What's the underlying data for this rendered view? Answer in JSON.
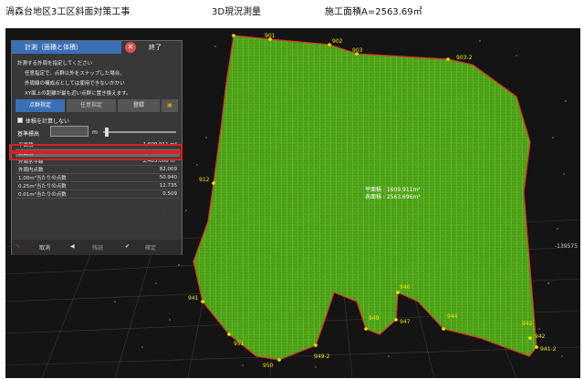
{
  "header": {
    "title": "渦森台地区3工区斜面対策工事",
    "subtitle": "3D現況測量",
    "area_text": "施工面積A=2563.69㎡"
  },
  "panel": {
    "title": "計測（面積と体積）",
    "close_label": "終了",
    "instructions": [
      "計測する外周を指定してください",
      "任意指定で、点群以外をスナップした場合、",
      "外周線の構成点としては使用できないかかい",
      "XY面上の距離が最も近い点群に置き換えます。"
    ],
    "buttons": [
      "点群指定",
      "任意指定",
      "登録"
    ],
    "volume_checkbox": "体積を計算しない",
    "base_height_label": "基準標高",
    "base_height_unit": "m",
    "rows": [
      {
        "label": "平面積",
        "value": "1,609.911 m²"
      },
      {
        "label": "表面積",
        "value": "2,563.696 m²"
      },
      {
        "label": "外周水平線",
        "value": "2,405.006 m²"
      },
      {
        "label": "外周内点数",
        "value": "82,009"
      },
      {
        "label": "1.00m²当たりの点数",
        "value": "50.940"
      },
      {
        "label": "0.25m²当たりの点数",
        "value": "12.735"
      },
      {
        "label": "0.01m²当たりの点数",
        "value": "0.509"
      }
    ],
    "footer": {
      "cancel": "取消",
      "back": "残読",
      "confirm": "確定"
    }
  },
  "scene": {
    "annotation_line1": "平面積 : 1609.911m²",
    "annotation_line2": "表面積 : 2563.696m²",
    "axis_value": "-139575",
    "points": [
      "901",
      "902",
      "903",
      "903-2",
      "912",
      "942",
      "942",
      "941-2",
      "944",
      "946",
      "947",
      "949",
      "950",
      "949-2",
      "951",
      "941"
    ],
    "colors": {
      "surface": "#58c21e",
      "outline": "#e0302b",
      "point": "#f2e600",
      "panel_title": "#3a6fb5"
    }
  }
}
